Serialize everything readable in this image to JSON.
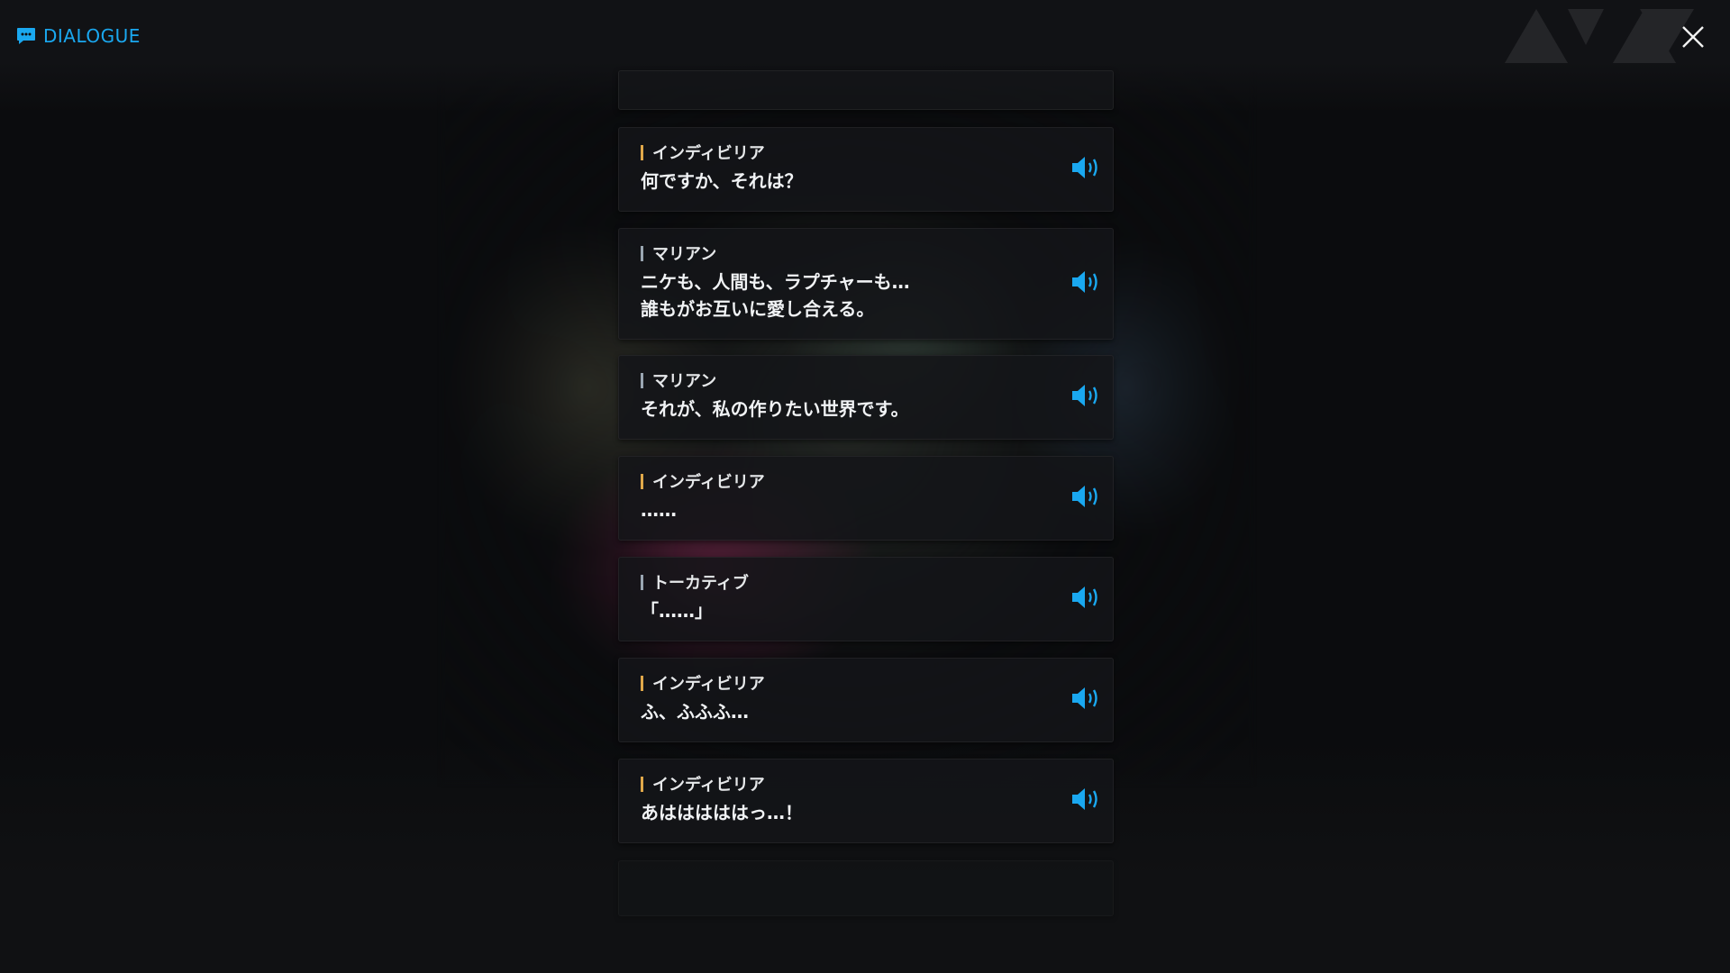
{
  "header": {
    "title": "DIALOGUE",
    "icon": "chat-bubble-icon",
    "accent": "#1aa8f0"
  },
  "close": {
    "icon": "close-icon"
  },
  "colors": {
    "indivilia": "#e0a84a",
    "marian": "#9aa6b2",
    "tocative": "#9aa6b2",
    "voice": "#1aa8f0"
  },
  "entries": [
    {
      "speaker": "インディビリア",
      "text": "何ですか、それは？"
    },
    {
      "speaker": "マリアン",
      "text": "ニケも、人間も、ラプチャーも…\n誰もがお互いに愛し合える。"
    },
    {
      "speaker": "マリアン",
      "text": "それが、私の作りたい世界です。"
    },
    {
      "speaker": "インディビリア",
      "text": "……"
    },
    {
      "speaker": "トーカティブ",
      "text": "「……」"
    },
    {
      "speaker": "インディビリア",
      "text": "ふ、ふふふ…"
    },
    {
      "speaker": "インディビリア",
      "text": "あはははははっ…！"
    }
  ]
}
